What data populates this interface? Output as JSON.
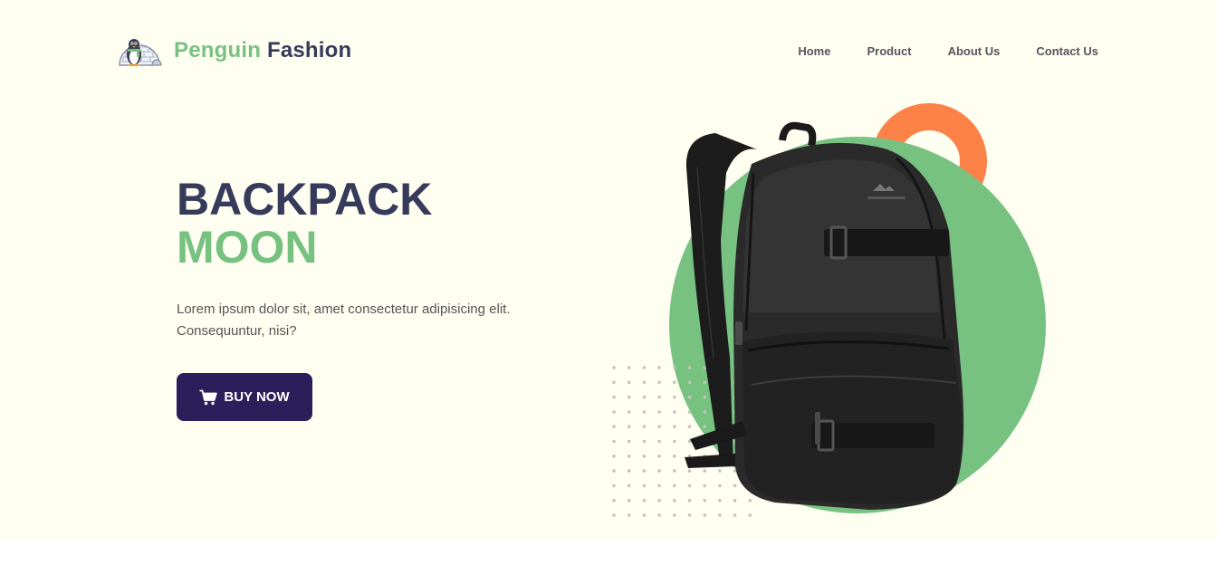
{
  "header": {
    "brand_part1": "Penguin",
    "brand_part2": "Fashion",
    "logo_icon": "penguin-igloo-logo",
    "nav": [
      "Home",
      "Product",
      "About Us",
      "Contact Us"
    ]
  },
  "hero": {
    "title_line1": "BACKPACK",
    "title_line2": "MOON",
    "description": "Lorem ipsum dolor sit, amet consectetur adipisicing elit. Consequuntur, nisi?",
    "cta_label": "BUY NOW",
    "cta_icon": "cart-icon",
    "product_image": "black-backpack"
  },
  "colors": {
    "background": "#fefef1",
    "green": "#77c281",
    "navy": "#363a5b",
    "button": "#2a1f5a",
    "orange": "#fd8248"
  }
}
